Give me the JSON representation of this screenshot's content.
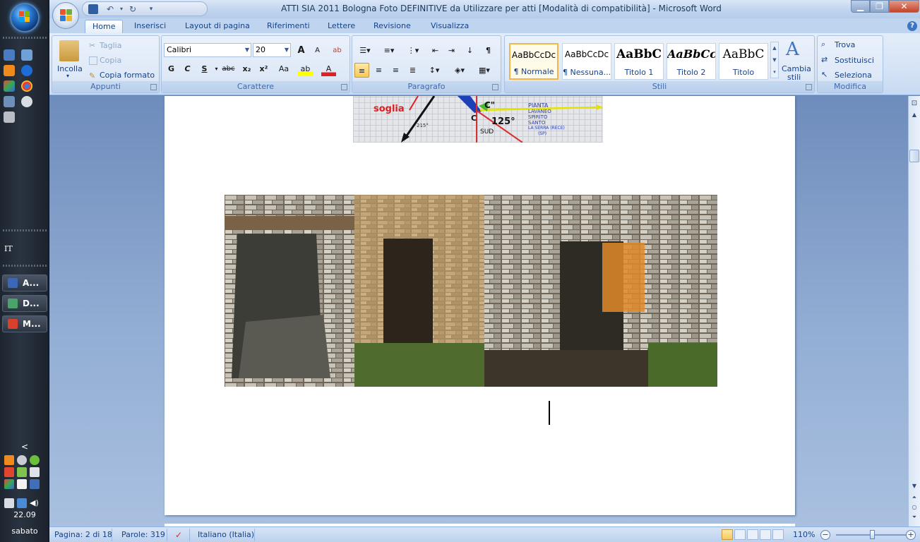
{
  "window": {
    "title": "ATTI SIA 2011 Bologna Foto DEFINITIVE  da Utilizzare per atti [Modalità di compatibilità] - Microsoft Word"
  },
  "tabs": [
    "Home",
    "Inserisci",
    "Layout di pagina",
    "Riferimenti",
    "Lettere",
    "Revisione",
    "Visualizza"
  ],
  "ribbon": {
    "clipboard": {
      "label": "Appunti",
      "paste": "Incolla",
      "cut": "Taglia",
      "copy": "Copia",
      "format_painter": "Copia formato"
    },
    "font": {
      "label": "Carattere",
      "name": "Calibri",
      "size": "20",
      "bold": "G",
      "italic": "C",
      "underline": "S",
      "strike": "abc",
      "subscript": "x₂",
      "superscript": "x²",
      "case": "Aa",
      "grow": "A",
      "shrink": "A"
    },
    "paragraph": {
      "label": "Paragrafo"
    },
    "styles": {
      "label": "Stili",
      "change_styles_1": "Cambia",
      "change_styles_2": "stili",
      "items": [
        {
          "sample": "AaBbCcDc",
          "name": "¶ Normale"
        },
        {
          "sample": "AaBbCcDc",
          "name": "¶ Nessuna..."
        },
        {
          "sample": "AaBbC",
          "name": "Titolo 1"
        },
        {
          "sample": "AaBbCc",
          "name": "Titolo 2"
        },
        {
          "sample": "AaBbC",
          "name": "Titolo"
        }
      ]
    },
    "editing": {
      "label": "Modifica",
      "find": "Trova",
      "replace": "Sostituisci",
      "select": "Seleziona"
    }
  },
  "document": {
    "diagram_labels": {
      "soglia": "soglia",
      "c2": "C\"",
      "c": "C",
      "angle": "125°",
      "sud": "SUD",
      "angle2": "215°",
      "pianta": "PIANTA",
      "lavaneo": "LAVANEO",
      "spirito": "SPIRITO",
      "santo": "SANTO",
      "laserra": "LA SERRA (RECE)",
      "sp": "(SP)"
    }
  },
  "statusbar": {
    "page": "Pagina: 2 di 18",
    "words": "Parole: 319",
    "language": "Italiano (Italia)",
    "zoom": "110%",
    "zoom_level": 110
  },
  "taskbar": {
    "lang": "IT",
    "tasks": [
      "A...",
      "D...",
      "M..."
    ],
    "time": "22.09",
    "day": "sabato",
    "chevron": "<"
  },
  "colors": {
    "ribbon": "#d5e3f6",
    "selected_style": "#f0b64a",
    "page": "#ffffff"
  }
}
